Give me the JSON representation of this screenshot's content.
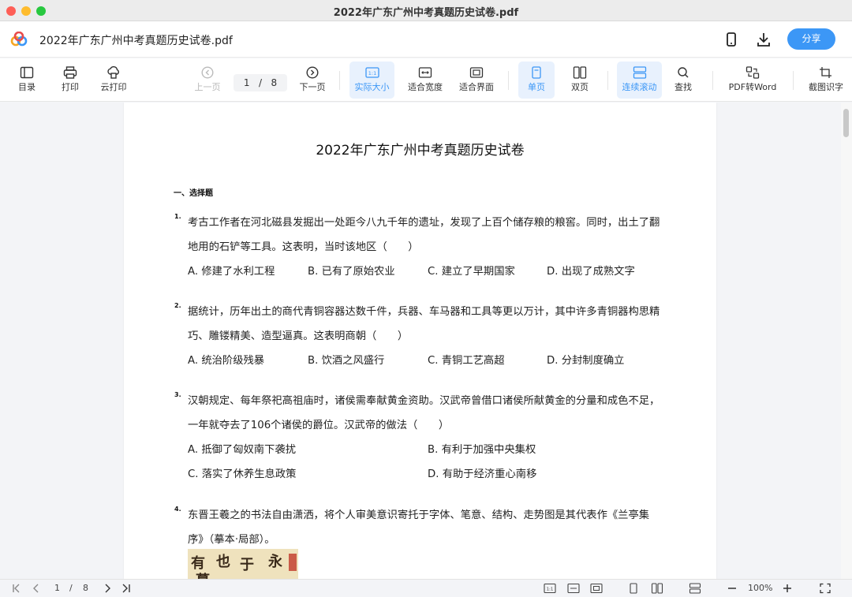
{
  "window": {
    "title": "2022年广东广州中考真题历史试卷.pdf"
  },
  "header": {
    "doc_title": "2022年广东广州中考真题历史试卷.pdf",
    "share_label": "分享"
  },
  "toolbar": {
    "toc": "目录",
    "print": "打印",
    "cloud_print": "云打印",
    "prev_page": "上一页",
    "next_page": "下一页",
    "current_page": "1",
    "page_sep": "/",
    "total_pages": "8",
    "actual_size": "实际大小",
    "fit_width": "适合宽度",
    "fit_page": "适合界面",
    "single_page": "单页",
    "double_page": "双页",
    "continuous_scroll": "连续滚动",
    "find": "查找",
    "pdf_to_word": "PDF转Word",
    "screenshot_ocr": "截图识字",
    "actual_size_icon_text": "1:1"
  },
  "paper": {
    "title": "2022年广东广州中考真题历史试卷",
    "section": "一、选择题",
    "questions": [
      {
        "num": "1.",
        "lines": [
          "考古工作者在河北磁县发掘出一处距今八九千年的遗址，发现了上百个储存粮的粮窖。同时，出土了翻",
          "地用的石铲等工具。这表明，当时该地区（　　）"
        ],
        "options": [
          "A. 修建了水利工程",
          "B. 已有了原始农业",
          "C. 建立了早期国家",
          "D. 出现了成熟文字"
        ]
      },
      {
        "num": "2.",
        "lines": [
          "据统计，历年出土的商代青铜容器达数千件，兵器、车马器和工具等更以万计，其中许多青铜器构思精",
          "巧、雕镂精美、造型逼真。这表明商朝（　　）"
        ],
        "options": [
          "A. 统治阶级残暴",
          "B. 饮酒之风盛行",
          "C. 青铜工艺高超",
          "D. 分封制度确立"
        ]
      },
      {
        "num": "3.",
        "lines": [
          "汉朝规定、每年祭祀高祖庙时，诸侯需奉献黄金资助。汉武帝曾借口诸侯所献黄金的分量和成色不足，",
          "一年就夺去了106个诸侯的爵位。汉武帝的做法（　　）"
        ],
        "options": [
          "A. 抵御了匈奴南下袭扰",
          "B. 有利于加强中央集权",
          "C. 落实了休养生息政策",
          "D. 有助于经济重心南移"
        ]
      },
      {
        "num": "4.",
        "lines": [
          "东晋王羲之的书法自由潇洒，将个人审美意识寄托于字体、笔意、结构、走势图是其代表作《兰亭集",
          "序》（摹本·局部）。"
        ]
      }
    ],
    "calligraphy_chars": [
      "有",
      "也",
      "于",
      "永",
      "暮"
    ]
  },
  "statusbar": {
    "current_page": "1",
    "page_sep": "/",
    "total_pages": "8",
    "zoom": "100%",
    "actual_size_icon_text": "1:1"
  },
  "colors": {
    "accent": "#3c97f6",
    "active_bg": "#e8f1fd"
  }
}
